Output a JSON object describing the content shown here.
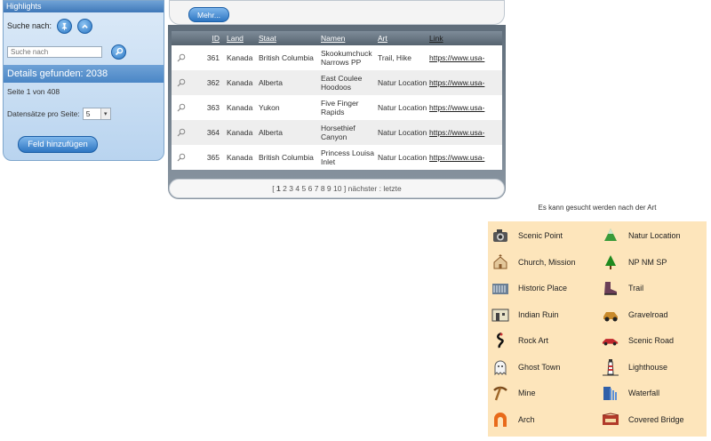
{
  "panel": {
    "title": "Highlights",
    "search_by_label": "Suche nach:",
    "search_placeholder": "Suche nach",
    "found_text": "Details gefunden: 2038",
    "page_text": "Seite 1 von 408",
    "per_page_label": "Datensätze pro Seite:",
    "per_page_value": "5",
    "add_field_label": "Feld hinzufügen"
  },
  "center": {
    "more_label": "Mehr...",
    "columns": [
      "ID",
      "Land",
      "Staat",
      "Namen",
      "Art",
      "Link"
    ],
    "rows": [
      {
        "id": "361",
        "land": "Kanada",
        "staat": "British Columbia",
        "namen": "Skookumchuck Narrows PP",
        "art": "Trail, Hike",
        "link": "https://www.usa-"
      },
      {
        "id": "362",
        "land": "Kanada",
        "staat": "Alberta",
        "namen": "East Coulee Hoodoos",
        "art": "Natur Location",
        "link": "https://www.usa-"
      },
      {
        "id": "363",
        "land": "Kanada",
        "staat": "Yukon",
        "namen": "Five Finger Rapids",
        "art": "Natur Location",
        "link": "https://www.usa-"
      },
      {
        "id": "364",
        "land": "Kanada",
        "staat": "Alberta",
        "namen": "Horsethief Canyon",
        "art": "Natur Location",
        "link": "https://www.usa-"
      },
      {
        "id": "365",
        "land": "Kanada",
        "staat": "British Columbia",
        "namen": "Princess Louisa Inlet",
        "art": "Natur Location",
        "link": "https://www.usa-"
      }
    ],
    "pager": {
      "open": "[",
      "current": "1",
      "pages": [
        "2",
        "3",
        "4",
        "5",
        "6",
        "7",
        "8",
        "9",
        "10"
      ],
      "close": "]",
      "next": "nächster",
      "sep": ":",
      "last": "letzte"
    }
  },
  "legend": {
    "title": "Es kann gesucht werden nach der Art",
    "items": [
      {
        "label": "Scenic Point",
        "icon": "camera-icon"
      },
      {
        "label": "Natur Location",
        "icon": "mountain-icon"
      },
      {
        "label": "Church, Mission",
        "icon": "church-icon"
      },
      {
        "label": "NP NM SP",
        "icon": "tree-icon"
      },
      {
        "label": "Historic Place",
        "icon": "building-icon"
      },
      {
        "label": "Trail",
        "icon": "hiking-boot-icon"
      },
      {
        "label": "Indian Ruin",
        "icon": "ruin-icon"
      },
      {
        "label": "Gravelroad",
        "icon": "offroad-car-icon"
      },
      {
        "label": "Rock Art",
        "icon": "petroglyph-icon"
      },
      {
        "label": "Scenic Road",
        "icon": "car-icon"
      },
      {
        "label": "Ghost Town",
        "icon": "ghost-icon"
      },
      {
        "label": "Lighthouse",
        "icon": "lighthouse-icon"
      },
      {
        "label": "Mine",
        "icon": "pickaxe-icon"
      },
      {
        "label": "Waterfall",
        "icon": "waterfall-icon"
      },
      {
        "label": "Arch",
        "icon": "arch-icon"
      },
      {
        "label": "Covered Bridge",
        "icon": "covered-bridge-icon"
      }
    ]
  }
}
